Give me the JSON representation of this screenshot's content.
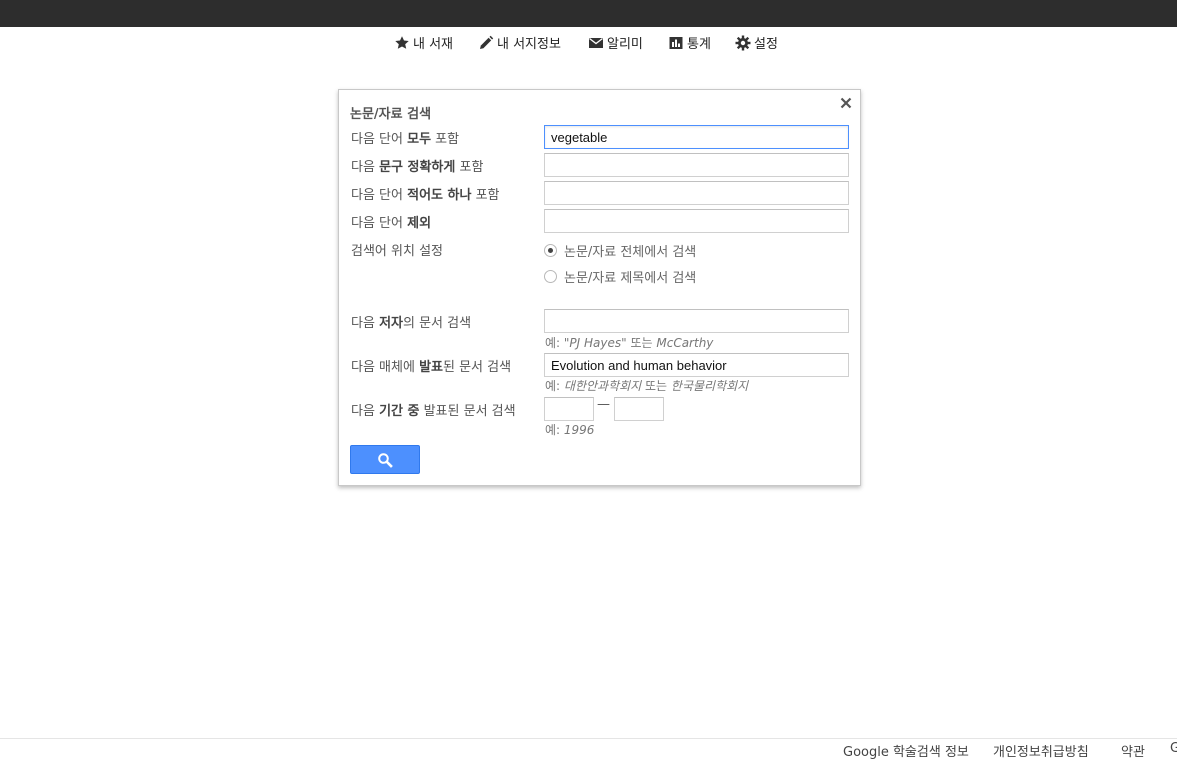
{
  "nav": {
    "items": [
      {
        "label": "내 서재",
        "icon": "star-icon"
      },
      {
        "label": "내 서지정보",
        "icon": "pencil-icon"
      },
      {
        "label": "알리미",
        "icon": "envelope-icon"
      },
      {
        "label": "통계",
        "icon": "chart-icon"
      },
      {
        "label": "설정",
        "icon": "gear-icon"
      }
    ]
  },
  "dialog": {
    "title": "논문/자료 검색",
    "rows": {
      "all_words": {
        "pre": "다음 단어 ",
        "bold": "모두",
        "post": " 포함",
        "value": "vegetable"
      },
      "exact_phrase": {
        "pre": "다음 ",
        "bold": "문구 정확하게",
        "post": " 포함",
        "value": ""
      },
      "any_words": {
        "pre": "다음 단어 ",
        "bold": "적어도 하나",
        "post": " 포함",
        "value": ""
      },
      "exclude": {
        "pre": "다음 단어 ",
        "bold": "제외",
        "post": "",
        "value": ""
      }
    },
    "location": {
      "label": "검색어 위치 설정",
      "options": [
        "논문/자료 전체에서 검색",
        "논문/자료 제목에서 검색"
      ],
      "selected_index": 0
    },
    "author": {
      "pre": "다음 ",
      "bold": "저자",
      "post": "의 문서 검색",
      "value": "",
      "hint_prefix": "예: ",
      "hint_ex1": "\"PJ Hayes\"",
      "hint_mid": " 또는 ",
      "hint_ex2": "McCarthy"
    },
    "publication": {
      "pre": "다음 매체에 ",
      "bold": "발표",
      "post": "된 문서 검색",
      "value": "Evolution and human behavior",
      "hint_prefix": "예: ",
      "hint_ex1": "대한안과학회지",
      "hint_mid": " 또는 ",
      "hint_ex2": "한국물리학회지"
    },
    "date_range": {
      "pre": "다음 ",
      "bold": "기간 중",
      "post": " 발표된 문서 검색",
      "from": "",
      "to": "",
      "separator": "—",
      "hint_prefix": "예: ",
      "hint_ex": "1996"
    },
    "search_icon": "search-icon",
    "close_icon": "close-icon"
  },
  "footer": {
    "links": [
      "Google 학술검색 정보",
      "개인정보취급방침",
      "약관",
      "G"
    ]
  },
  "colors": {
    "topbar": "#2d2d2d",
    "button": "#4d90fe",
    "focus_border": "#4d90fe"
  }
}
